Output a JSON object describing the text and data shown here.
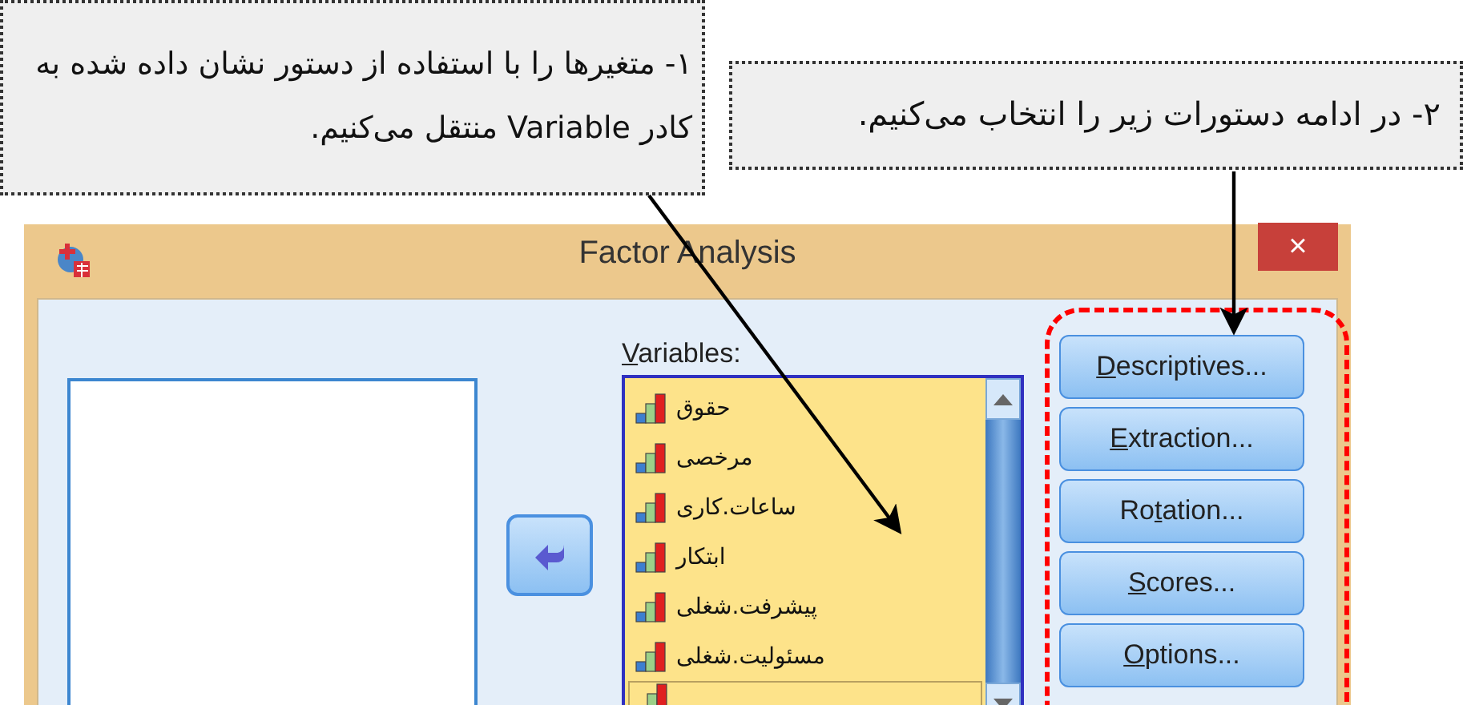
{
  "note_1": {
    "text": "۱- متغیرها را با استفاده از دستور نشان داده شده به کادر Variable منتقل می‌کنیم."
  },
  "note_2": {
    "text": "۲- در ادامه دستورات زیر را انتخاب می‌کنیم."
  },
  "window": {
    "title": "Factor Analysis",
    "close": "×"
  },
  "variables": {
    "label": {
      "key": "V",
      "post": "ariables:"
    },
    "items": [
      {
        "name": "حقوق"
      },
      {
        "name": "مرخصی"
      },
      {
        "name": "ساعات.کاری"
      },
      {
        "name": "ابتکار"
      },
      {
        "name": "پیشرفت.شغلی"
      },
      {
        "name": "مسئولیت.شغلی"
      }
    ]
  },
  "buttons": [
    {
      "key": "D",
      "post": "escriptives..."
    },
    {
      "key": "E",
      "post": "xtraction..."
    },
    {
      "pre": "Ro",
      "key": "t",
      "post": "ation..."
    },
    {
      "key": "S",
      "post": "cores..."
    },
    {
      "key": "O",
      "post": "ptions..."
    }
  ]
}
